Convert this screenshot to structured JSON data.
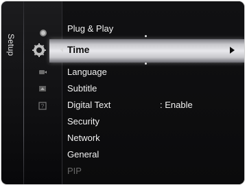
{
  "side_label": "Setup",
  "menu": {
    "above_item": "Plug & Play",
    "selected": {
      "label": "Time",
      "arrow": "right"
    },
    "items": [
      {
        "label": "Language"
      },
      {
        "label": "Subtitle"
      },
      {
        "label": "Digital Text",
        "value": ": Enable"
      },
      {
        "label": "Security"
      },
      {
        "label": "Network"
      },
      {
        "label": "General"
      },
      {
        "label": "PIP",
        "disabled": true
      }
    ]
  },
  "nav_icons": [
    "picture-icon",
    "gear-settings-icon",
    "input-source-icon",
    "application-icon",
    "support-help-icon"
  ]
}
